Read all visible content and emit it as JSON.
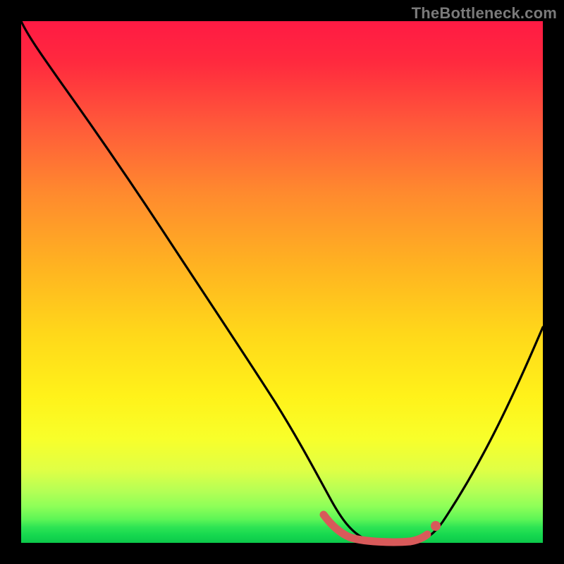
{
  "watermark": "TheBottleneck.com",
  "colors": {
    "frame_bg": "#000000",
    "gradient_top": "#ff1a44",
    "gradient_bottom": "#0cc84a",
    "curve": "#000000",
    "marker": "#d85a5a"
  },
  "chart_data": {
    "type": "line",
    "title": "",
    "xlabel": "",
    "ylabel": "",
    "xlim": [
      0,
      100
    ],
    "ylim": [
      0,
      100
    ],
    "grid": false,
    "legend": false,
    "series": [
      {
        "name": "bottleneck-curve",
        "x": [
          0,
          3,
          8,
          14,
          20,
          26,
          32,
          38,
          44,
          50,
          53,
          56,
          60,
          64,
          68,
          72,
          76,
          80,
          85,
          90,
          95,
          100
        ],
        "values": [
          100,
          97,
          92,
          86,
          78,
          70,
          61.5,
          52,
          42,
          31,
          24,
          17,
          10,
          5,
          2,
          1,
          1,
          4,
          11,
          23,
          37,
          53
        ]
      }
    ],
    "markers": [
      {
        "name": "trough-segment",
        "x_start": 58,
        "x_end": 77,
        "y": 1,
        "style": "thick-red"
      },
      {
        "name": "trough-dot",
        "x": 78,
        "y": 3,
        "style": "red-dot"
      }
    ]
  }
}
